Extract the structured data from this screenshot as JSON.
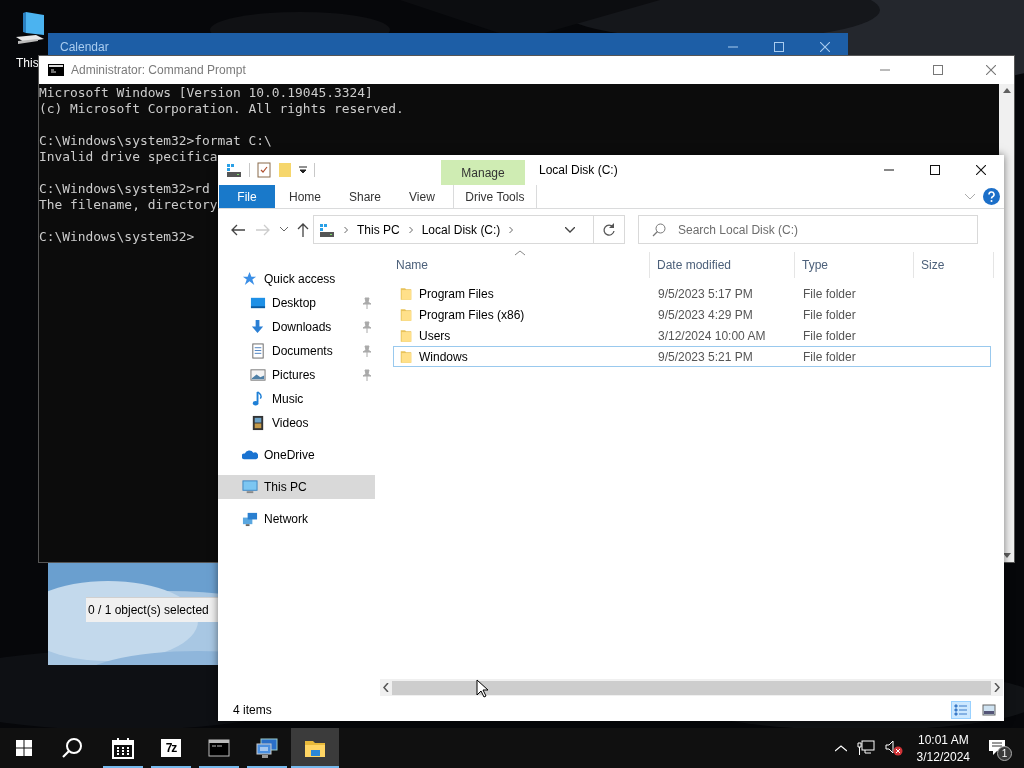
{
  "desktop": {
    "icons": [
      {
        "label": "This"
      }
    ]
  },
  "calendar": {
    "title": "Calendar",
    "status": "0 / 1 object(s) selected"
  },
  "command_prompt": {
    "title": "Administrator: Command Prompt",
    "blocks": [
      [
        "Microsoft Windows [Version 10.0.19045.3324]",
        "(c) Microsoft Corporation. All rights reserved."
      ],
      [
        "C:\\Windows\\system32>format C:\\",
        "Invalid drive specifica"
      ],
      [
        "C:\\Windows\\system32>rd",
        "The filename, directory"
      ],
      [
        "C:\\Windows\\system32>"
      ]
    ]
  },
  "explorer": {
    "title": "Local Disk (C:)",
    "context_tab": {
      "group": "Manage",
      "label": "Drive Tools"
    },
    "tabs": [
      {
        "label": "File",
        "kind": "file"
      },
      {
        "label": "Home",
        "kind": "tab"
      },
      {
        "label": "Share",
        "kind": "tab"
      },
      {
        "label": "View",
        "kind": "tab"
      }
    ],
    "breadcrumb": [
      "This PC",
      "Local Disk (C:)"
    ],
    "search": {
      "placeholder": "Search Local Disk (C:)"
    },
    "nav": [
      {
        "label": "Quick access",
        "kind": "star",
        "selected": false,
        "children": [
          {
            "label": "Desktop",
            "kind": "desktop",
            "pinned": true,
            "selected": false
          },
          {
            "label": "Downloads",
            "kind": "downloads",
            "pinned": true,
            "selected": false
          },
          {
            "label": "Documents",
            "kind": "documents",
            "pinned": true,
            "selected": false
          },
          {
            "label": "Pictures",
            "kind": "pictures",
            "pinned": true,
            "selected": false
          },
          {
            "label": "Music",
            "kind": "music",
            "pinned": false,
            "selected": false
          },
          {
            "label": "Videos",
            "kind": "videos",
            "pinned": false,
            "selected": false
          }
        ]
      },
      {
        "label": "OneDrive",
        "kind": "cloud",
        "selected": false
      },
      {
        "label": "This PC",
        "kind": "computer",
        "selected": true
      },
      {
        "label": "Network",
        "kind": "network",
        "selected": false
      }
    ],
    "columns": [
      "Name",
      "Date modified",
      "Type",
      "Size"
    ],
    "rows": [
      {
        "name": "Program Files",
        "date": "9/5/2023 5:17 PM",
        "type": "File folder",
        "focused": false
      },
      {
        "name": "Program Files (x86)",
        "date": "9/5/2023 4:29 PM",
        "type": "File folder",
        "focused": false
      },
      {
        "name": "Users",
        "date": "3/12/2024 10:00 AM",
        "type": "File folder",
        "focused": false
      },
      {
        "name": "Windows",
        "date": "9/5/2023 5:21 PM",
        "type": "File folder",
        "focused": true
      }
    ],
    "status": "4 items",
    "views": [
      {
        "kind": "details",
        "selected": true
      },
      {
        "kind": "tiles",
        "selected": false
      }
    ]
  },
  "taskbar": {
    "apps": [
      {
        "kind": "calendar",
        "running": true,
        "active": false
      },
      {
        "kind": "archiver",
        "glyph": "7z",
        "running": true,
        "active": false
      },
      {
        "kind": "console",
        "running": true,
        "active": false
      },
      {
        "kind": "remote",
        "running": true,
        "active": false
      },
      {
        "kind": "explorer",
        "running": true,
        "active": true
      }
    ],
    "time": "10:01 AM",
    "date": "3/12/2024",
    "notifications": "1"
  }
}
